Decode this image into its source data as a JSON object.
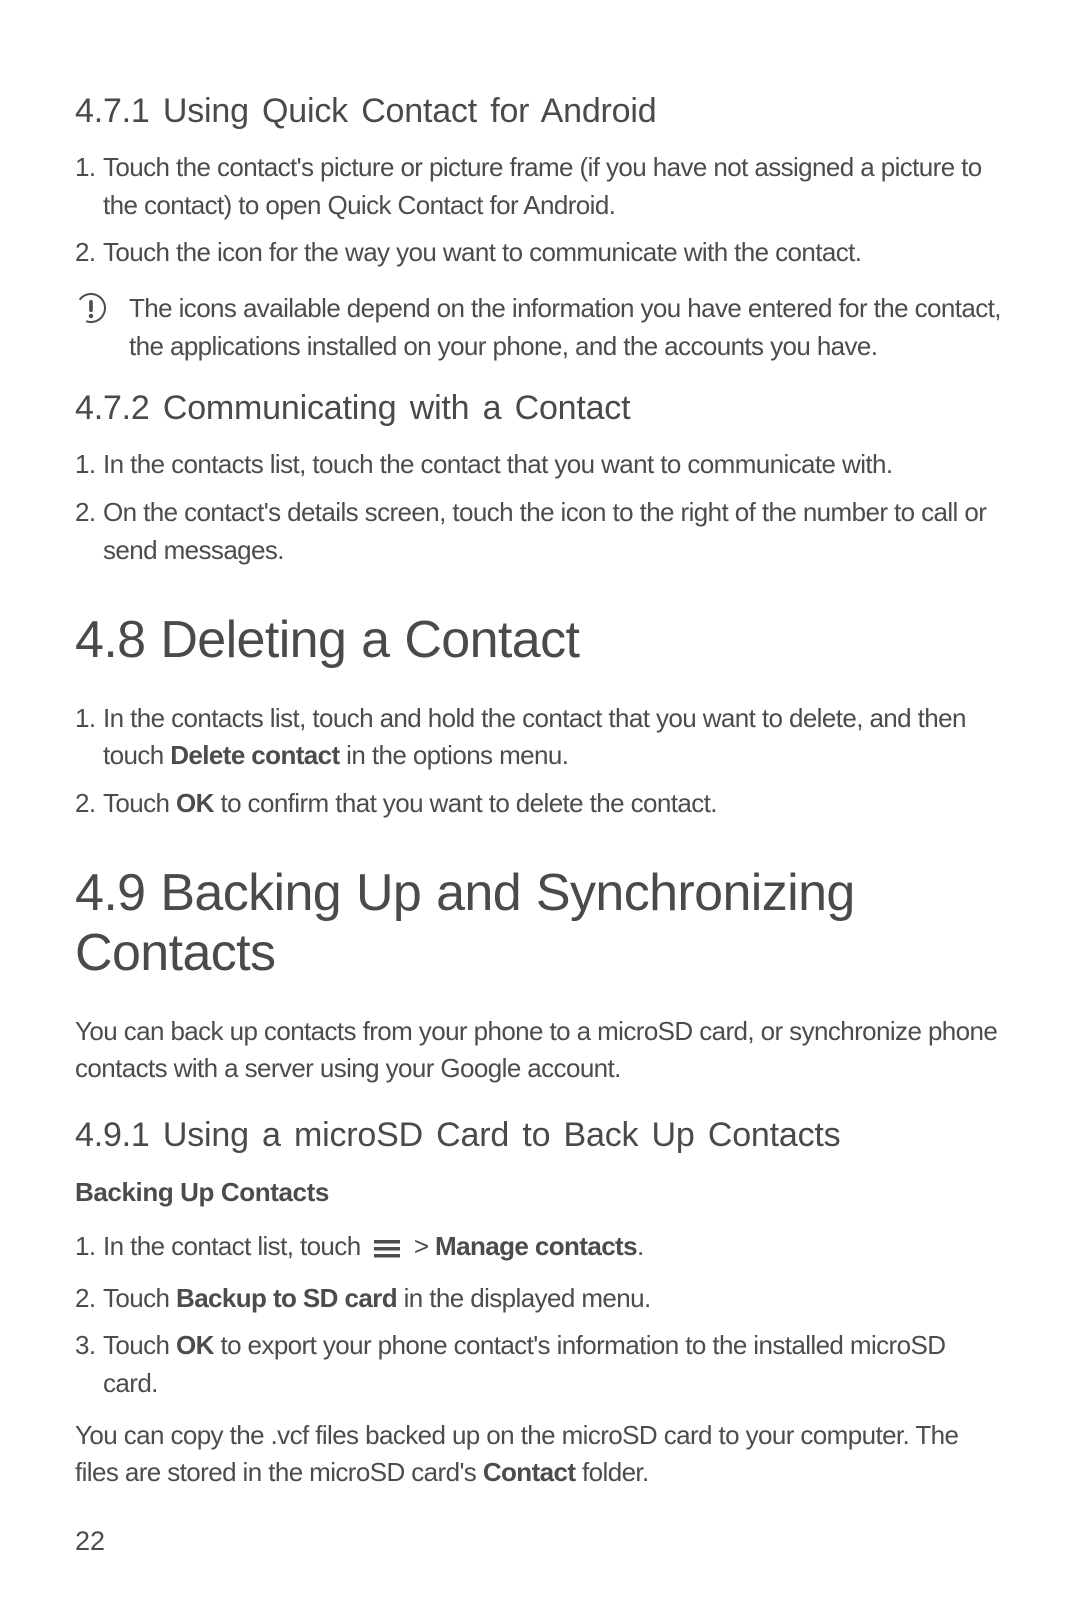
{
  "page_number": "22",
  "s471": {
    "heading": "4.7.1  Using Quick Contact for Android",
    "step1": "Touch the contact's picture or picture frame (if you have not assigned a picture to the contact) to open Quick Contact for Android.",
    "step2": "Touch the icon for the way you want to communicate with the contact.",
    "note": "The icons available depend on the information you have entered for the contact, the applications installed on your phone, and the accounts you have."
  },
  "s472": {
    "heading": "4.7.2  Communicating with a Contact",
    "step1": "In the contacts list, touch the contact that you want to communicate with.",
    "step2": "On the contact's details screen, touch the icon to the right of the number to call or send messages."
  },
  "s48": {
    "heading": "4.8  Deleting a Contact",
    "step1_pre": "In the contacts list, touch and hold the contact that you want to delete, and then touch ",
    "step1_bold": "Delete contact",
    "step1_post": " in the options menu.",
    "step2_pre": "Touch ",
    "step2_bold": "OK",
    "step2_post": " to confirm that you want to delete the contact."
  },
  "s49": {
    "heading": "4.9  Backing Up and Synchronizing Contacts",
    "intro": "You can back up contacts from your phone to a microSD card, or synchronize phone contacts with a server using your Google account."
  },
  "s491": {
    "heading": "4.9.1  Using a microSD Card to Back Up Contacts",
    "sub": "Backing Up Contacts",
    "step1_pre": "In the contact list, touch ",
    "step1_sep": "  >  ",
    "step1_bold": "Manage contacts",
    "step1_post": ".",
    "step2_pre": "Touch ",
    "step2_bold": "Backup to SD card",
    "step2_post": " in the displayed menu.",
    "step3_pre": "Touch ",
    "step3_bold": "OK",
    "step3_post": " to export your phone contact's information to the installed microSD card.",
    "footer_pre": "You can copy the .vcf files backed up on the microSD card to your computer. The files are stored in the microSD card's ",
    "footer_bold": "Contact",
    "footer_post": " folder."
  },
  "numbers": {
    "n1": "1.",
    "n2": "2.",
    "n3": "3."
  },
  "icons": {
    "note": "note-icon",
    "menu": "menu-icon"
  }
}
